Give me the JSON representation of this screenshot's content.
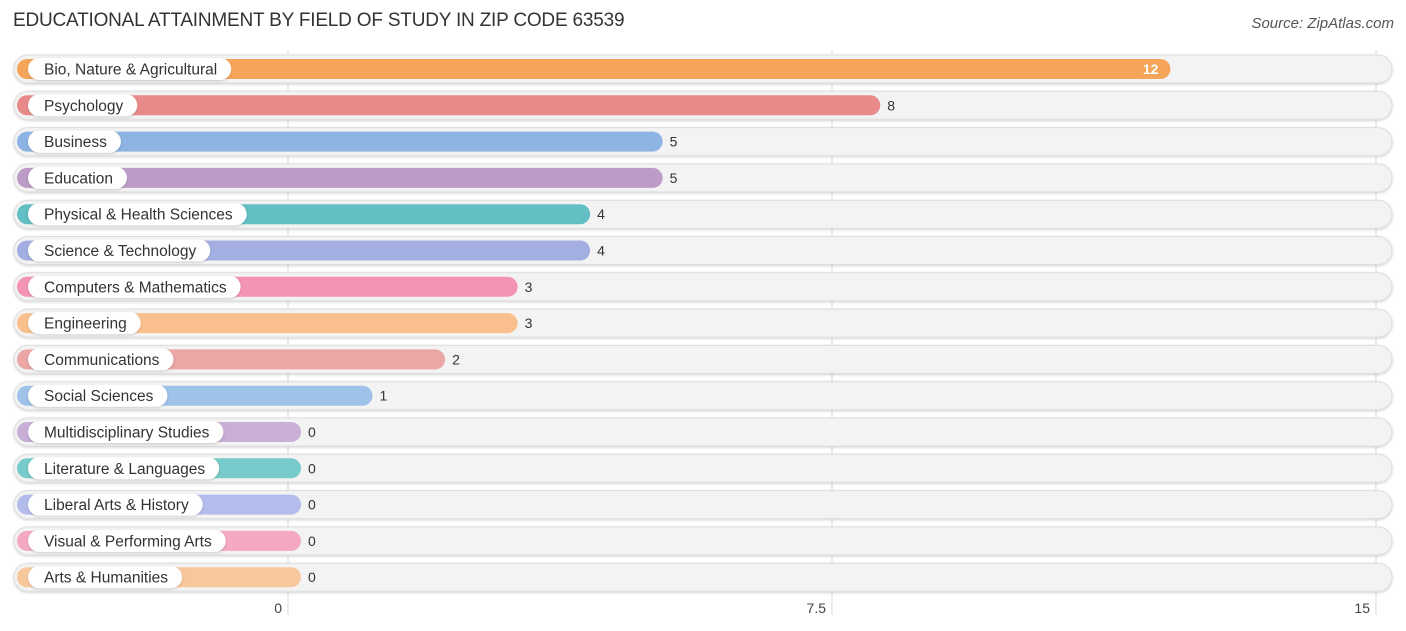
{
  "header": {
    "title": "EDUCATIONAL ATTAINMENT BY FIELD OF STUDY IN ZIP CODE 63539",
    "source": "Source: ZipAtlas.com"
  },
  "chart_data": {
    "type": "bar",
    "orientation": "horizontal",
    "title": "EDUCATIONAL ATTAINMENT BY FIELD OF STUDY IN ZIP CODE 63539",
    "xlabel": "",
    "ylabel": "",
    "xlim": [
      0,
      15
    ],
    "xticks": [
      0,
      7.5,
      15
    ],
    "xtick_labels": [
      "0",
      "7.5",
      "15"
    ],
    "grid": true,
    "categories": [
      "Bio, Nature & Agricultural",
      "Psychology",
      "Business",
      "Education",
      "Physical & Health Sciences",
      "Science & Technology",
      "Computers & Mathematics",
      "Engineering",
      "Communications",
      "Social Sciences",
      "Multidisciplinary Studies",
      "Literature & Languages",
      "Liberal Arts & History",
      "Visual & Performing Arts",
      "Arts & Humanities"
    ],
    "values": [
      12,
      8,
      5,
      5,
      4,
      4,
      3,
      3,
      2,
      1,
      0,
      0,
      0,
      0,
      0
    ],
    "value_labels": [
      "12",
      "8",
      "5",
      "5",
      "4",
      "4",
      "3",
      "3",
      "2",
      "1",
      "0",
      "0",
      "0",
      "0",
      "0"
    ],
    "colors": [
      "#F5A55A",
      "#E88A8A",
      "#8DB4E2",
      "#BC9BC8",
      "#62BFC4",
      "#A3AEE3",
      "#F394B2",
      "#F9C08E",
      "#ECA6A6",
      "#9EC2E8",
      "#C9AED6",
      "#78CBCB",
      "#B3BCEA",
      "#F5A8C3",
      "#F9C79C"
    ]
  }
}
